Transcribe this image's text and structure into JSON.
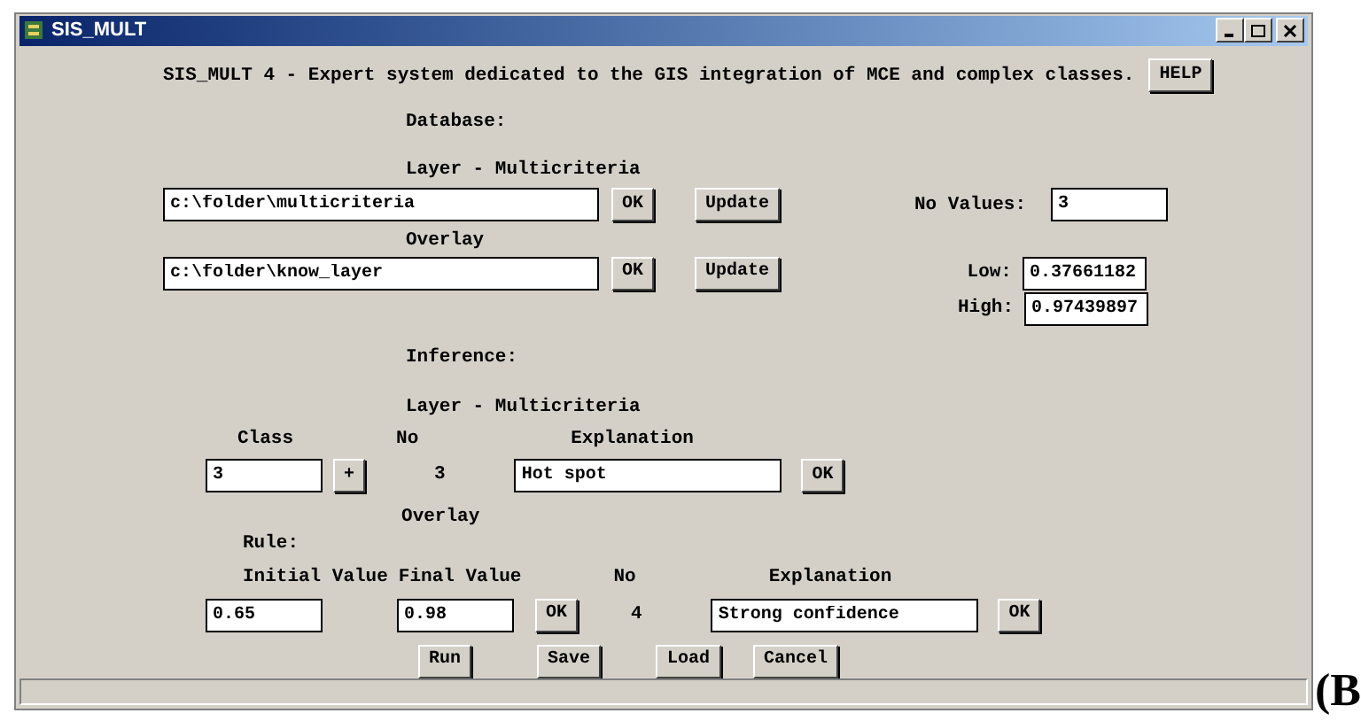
{
  "window": {
    "title": "SIS_MULT"
  },
  "header": {
    "text": "SIS_MULT 4 - Expert system dedicated to the GIS integration of MCE and complex classes.",
    "help_button": "HELP"
  },
  "database": {
    "label": "Database:",
    "layer": {
      "label": "Layer - Multicriteria",
      "path": "c:\\folder\\multicriteria",
      "ok": "OK",
      "update": "Update"
    },
    "no_values": {
      "label": "No Values:",
      "value": "3"
    },
    "overlay": {
      "label": "Overlay",
      "path": "c:\\folder\\know_layer",
      "ok": "OK",
      "update": "Update"
    },
    "low": {
      "label": "Low:",
      "value": "0.37661182"
    },
    "high": {
      "label": "High:",
      "value": "0.97439897"
    }
  },
  "inference": {
    "label": "Inference:",
    "layer": {
      "label": "Layer - Multicriteria",
      "columns": [
        "Class",
        "No",
        "Explanation"
      ],
      "class_value": "3",
      "plus": "+",
      "no": "3",
      "explanation": "Hot spot",
      "ok": "OK"
    },
    "overlay": {
      "label": "Overlay",
      "rule_label": "Rule:",
      "columns": [
        "Initial Value",
        "Final Value",
        "No",
        "Explanation"
      ],
      "initial_value": "0.65",
      "final_value": "0.98",
      "ok": "OK",
      "no": "4",
      "explanation": "Strong confidence",
      "ok2": "OK"
    }
  },
  "buttons": [
    "Run",
    "Save",
    "Load",
    "Cancel"
  ],
  "figure_label": "(B"
}
